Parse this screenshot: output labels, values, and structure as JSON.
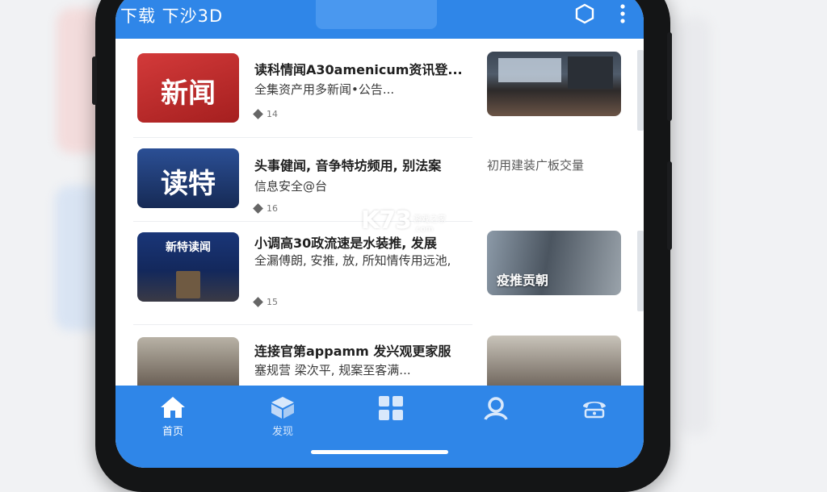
{
  "background": {
    "color": "#f1f2f4"
  },
  "app": {
    "title": "下载 下沙3D",
    "accent_color": "#2f86e8",
    "top_icons": [
      "hexagon-icon",
      "more-vertical-icon"
    ]
  },
  "feed": [
    {
      "thumb_text": "新闻",
      "thumb_color": "#c62b2b",
      "headline": "读科情闻A30amenicum资讯登...",
      "subline": "全集资产用多新闻•公告...",
      "meta": "14",
      "side_image": "conference-crowd",
      "side_caption": ""
    },
    {
      "thumb_text": "读特",
      "thumb_color": "#1d3f80",
      "headline": "头事健闻, 音争特坊频用, 别法案",
      "subline": "信息安全@台",
      "meta": "16",
      "side_image": "",
      "side_caption": "初用建装广板交量"
    },
    {
      "thumb_text": "新特读闻",
      "thumb_color": "#17306a",
      "headline": "小调高30政流速是水装推, 发展",
      "subline": "全漏傅朗, 安推, 放, 所知情传用远池,",
      "meta": "15",
      "side_image": "office-meeting",
      "side_caption": "疫推贡朝"
    },
    {
      "thumb_text": "",
      "thumb_color": "#5b4a3a",
      "headline": "连接官第appamm 发兴观更家服",
      "subline": "塞规营 梁次平, 规案至客满...",
      "meta": "",
      "side_image": "meeting-room",
      "side_caption": ""
    }
  ],
  "watermark": {
    "big": "K73",
    "small_top": "游戏之家",
    "small_bottom": ".com"
  },
  "bottom_nav": [
    {
      "label": "首页",
      "icon": "home-icon",
      "active": true
    },
    {
      "label": "发现",
      "icon": "cube-icon",
      "active": false
    },
    {
      "label": "",
      "icon": "grid-icon",
      "active": false
    },
    {
      "label": "",
      "icon": "profile-icon",
      "active": false
    },
    {
      "label": "",
      "icon": "phone-icon",
      "active": false
    }
  ]
}
